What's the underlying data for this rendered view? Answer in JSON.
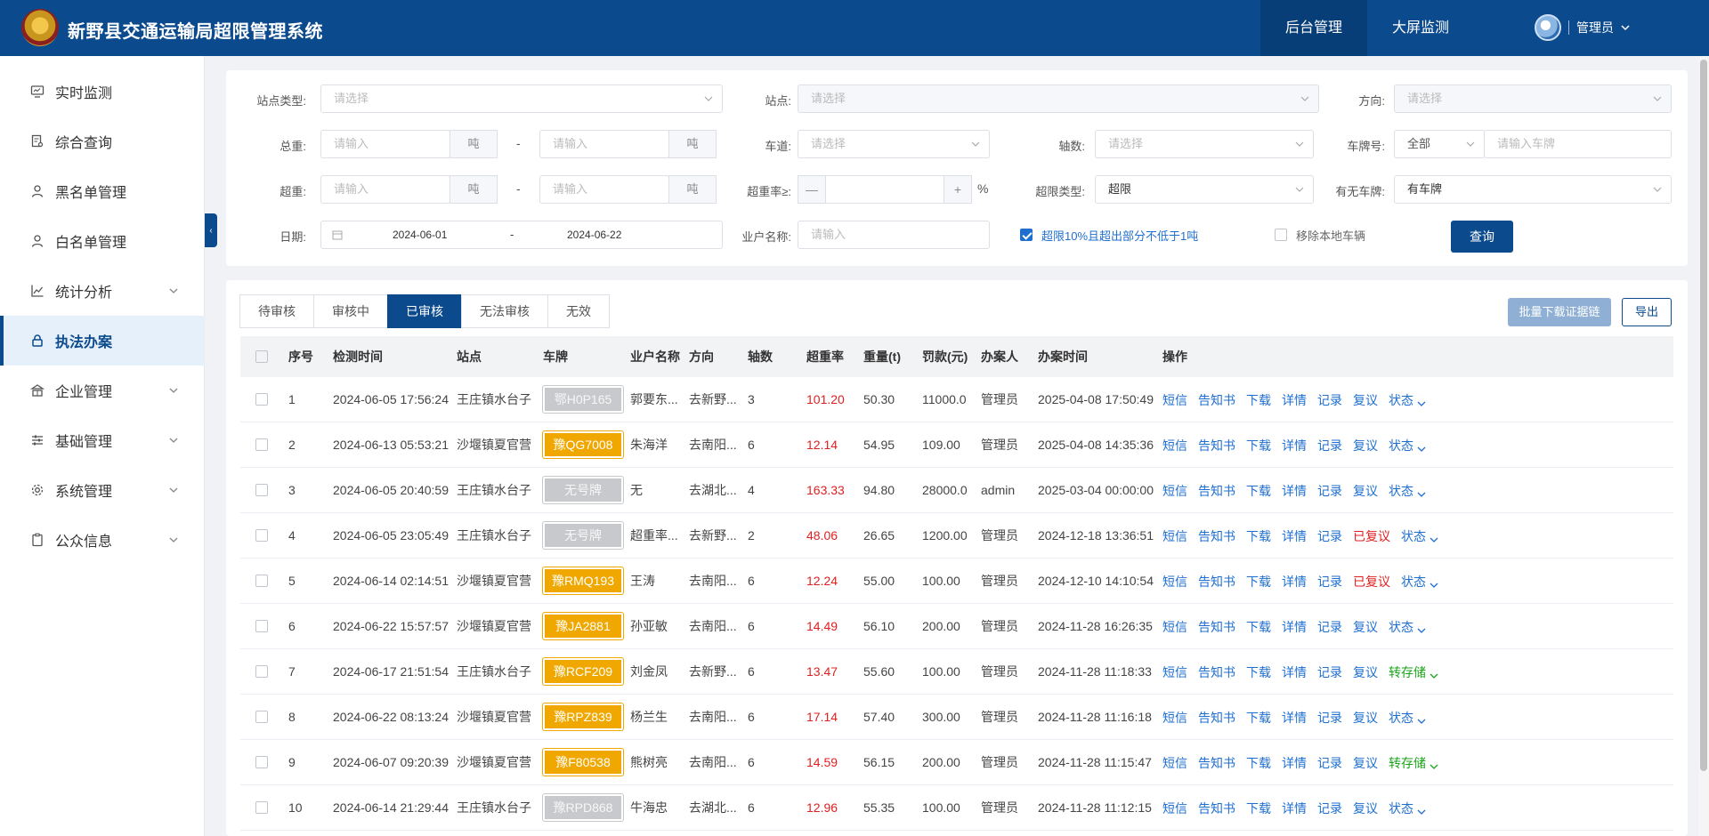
{
  "header": {
    "title": "新野县交通运输局超限管理系统",
    "nav": [
      "后台管理",
      "大屏监测"
    ],
    "user": "管理员"
  },
  "sidebar": {
    "items": [
      {
        "label": "实时监测",
        "icon": "monitor-icon",
        "expandable": false
      },
      {
        "label": "综合查询",
        "icon": "document-search-icon",
        "expandable": false
      },
      {
        "label": "黑名单管理",
        "icon": "user-icon",
        "expandable": false
      },
      {
        "label": "白名单管理",
        "icon": "user-icon",
        "expandable": false
      },
      {
        "label": "统计分析",
        "icon": "chart-icon",
        "expandable": true
      },
      {
        "label": "执法办案",
        "icon": "lock-icon",
        "expandable": false,
        "active": true
      },
      {
        "label": "企业管理",
        "icon": "building-icon",
        "expandable": true
      },
      {
        "label": "基础管理",
        "icon": "sliders-icon",
        "expandable": true
      },
      {
        "label": "系统管理",
        "icon": "gear-icon",
        "expandable": true
      },
      {
        "label": "公众信息",
        "icon": "clipboard-icon",
        "expandable": true
      }
    ]
  },
  "filters": {
    "station_type": {
      "label": "站点类型:",
      "placeholder": "请选择"
    },
    "station": {
      "label": "站点:",
      "placeholder": "请选择"
    },
    "direction": {
      "label": "方向:",
      "placeholder": "请选择"
    },
    "total_weight": {
      "label": "总重:",
      "placeholder": "请输入",
      "unit": "吨"
    },
    "lane": {
      "label": "车道:",
      "placeholder": "请选择"
    },
    "axles": {
      "label": "轴数:",
      "placeholder": "请选择"
    },
    "plate_no": {
      "label": "车牌号:",
      "select": "全部",
      "placeholder": "请输入车牌"
    },
    "overweight": {
      "label": "超重:",
      "placeholder": "请输入",
      "unit": "吨"
    },
    "over_rate": {
      "label": "超重率≥:",
      "minus": "—",
      "plus": "+",
      "unit": "%"
    },
    "overlimit_type": {
      "label": "超限类型:",
      "value": "超限"
    },
    "has_plate": {
      "label": "有无车牌:",
      "value": "有车牌"
    },
    "date": {
      "label": "日期:",
      "start": "2024-06-01",
      "sep": "-",
      "end": "2024-06-22"
    },
    "owner": {
      "label": "业户名称:",
      "placeholder": "请输入"
    },
    "check1": {
      "label": "超限10%且超出部分不低于1吨",
      "checked": true
    },
    "check2": {
      "label": "移除本地车辆",
      "checked": false
    },
    "query_button": "查询",
    "range_sep": "-"
  },
  "tabs": [
    "待审核",
    "审核中",
    "已审核",
    "无法审核",
    "无效"
  ],
  "active_tab": 2,
  "actions": {
    "batch_download": "批量下载证据链",
    "export": "导出"
  },
  "table": {
    "columns": [
      "序号",
      "检测时间",
      "站点",
      "车牌",
      "业户名称",
      "方向",
      "轴数",
      "超重率",
      "重量(t)",
      "罚款(元)",
      "办案人",
      "办案时间",
      "操作"
    ],
    "rows": [
      {
        "no": "1",
        "time": "2024-06-05 17:56:24",
        "station": "王庄镇水台子",
        "plate": "鄂H0P165",
        "plate_color": "gray",
        "owner": "郭要东...",
        "direction": "去新野...",
        "axles": "3",
        "rate": "101.20",
        "weight": "50.30",
        "fine": "11000.0",
        "handler": "管理员",
        "handle_time": "2025-04-08 17:50:49",
        "review": "复议",
        "review_red": false,
        "status": "状态",
        "status_color": "blue"
      },
      {
        "no": "2",
        "time": "2024-06-13 05:53:21",
        "station": "沙堰镇夏官营",
        "plate": "豫QG7008",
        "plate_color": "yellow",
        "owner": "朱海洋",
        "direction": "去南阳...",
        "axles": "6",
        "rate": "12.14",
        "weight": "54.95",
        "fine": "109.00",
        "handler": "管理员",
        "handle_time": "2025-04-08 14:35:36",
        "review": "复议",
        "review_red": false,
        "status": "状态",
        "status_color": "blue"
      },
      {
        "no": "3",
        "time": "2024-06-05 20:40:59",
        "station": "王庄镇水台子",
        "plate": "无号牌",
        "plate_color": "gray",
        "owner": "无",
        "direction": "去湖北...",
        "axles": "4",
        "rate": "163.33",
        "weight": "94.80",
        "fine": "28000.0",
        "handler": "admin",
        "handle_time": "2025-03-04 00:00:00",
        "review": "复议",
        "review_red": false,
        "status": "状态",
        "status_color": "blue"
      },
      {
        "no": "4",
        "time": "2024-06-05 23:05:49",
        "station": "王庄镇水台子",
        "plate": "无号牌",
        "plate_color": "gray",
        "owner": "超重率...",
        "direction": "去新野...",
        "axles": "2",
        "rate": "48.06",
        "weight": "26.65",
        "fine": "1200.00",
        "handler": "管理员",
        "handle_time": "2024-12-18 13:36:51",
        "review": "已复议",
        "review_red": true,
        "status": "状态",
        "status_color": "blue"
      },
      {
        "no": "5",
        "time": "2024-06-14 02:14:51",
        "station": "沙堰镇夏官营",
        "plate": "豫RMQ193",
        "plate_color": "yellow",
        "owner": "王涛",
        "direction": "去南阳...",
        "axles": "6",
        "rate": "12.24",
        "weight": "55.00",
        "fine": "100.00",
        "handler": "管理员",
        "handle_time": "2024-12-10 14:10:54",
        "review": "已复议",
        "review_red": true,
        "status": "状态",
        "status_color": "blue"
      },
      {
        "no": "6",
        "time": "2024-06-22 15:57:57",
        "station": "沙堰镇夏官营",
        "plate": "豫JA2881",
        "plate_color": "yellow",
        "owner": "孙亚敏",
        "direction": "去南阳...",
        "axles": "6",
        "rate": "14.49",
        "weight": "56.10",
        "fine": "200.00",
        "handler": "管理员",
        "handle_time": "2024-11-28 16:26:35",
        "review": "复议",
        "review_red": false,
        "status": "状态",
        "status_color": "blue"
      },
      {
        "no": "7",
        "time": "2024-06-17 21:51:54",
        "station": "王庄镇水台子",
        "plate": "豫RCF209",
        "plate_color": "yellow",
        "owner": "刘金凤",
        "direction": "去新野...",
        "axles": "6",
        "rate": "13.47",
        "weight": "55.60",
        "fine": "100.00",
        "handler": "管理员",
        "handle_time": "2024-11-28 11:18:33",
        "review": "复议",
        "review_red": false,
        "status": "转存储",
        "status_color": "green"
      },
      {
        "no": "8",
        "time": "2024-06-22 08:13:24",
        "station": "沙堰镇夏官营",
        "plate": "豫RPZ839",
        "plate_color": "yellow",
        "owner": "杨兰生",
        "direction": "去南阳...",
        "axles": "6",
        "rate": "17.14",
        "weight": "57.40",
        "fine": "300.00",
        "handler": "管理员",
        "handle_time": "2024-11-28 11:16:18",
        "review": "复议",
        "review_red": false,
        "status": "状态",
        "status_color": "blue"
      },
      {
        "no": "9",
        "time": "2024-06-07 09:20:39",
        "station": "沙堰镇夏官营",
        "plate": "豫F80538",
        "plate_color": "yellow",
        "owner": "熊树亮",
        "direction": "去南阳...",
        "axles": "6",
        "rate": "14.59",
        "weight": "56.15",
        "fine": "200.00",
        "handler": "管理员",
        "handle_time": "2024-11-28 11:15:47",
        "review": "复议",
        "review_red": false,
        "status": "转存储",
        "status_color": "green"
      },
      {
        "no": "10",
        "time": "2024-06-14 21:29:44",
        "station": "王庄镇水台子",
        "plate": "豫RPD868",
        "plate_color": "gray",
        "owner": "牛海忠",
        "direction": "去湖北...",
        "axles": "6",
        "rate": "12.96",
        "weight": "55.35",
        "fine": "100.00",
        "handler": "管理员",
        "handle_time": "2024-11-28 11:12:15",
        "review": "复议",
        "review_red": false,
        "status": "状态",
        "status_color": "blue"
      }
    ],
    "ops": [
      "短信",
      "告知书",
      "下载",
      "详情",
      "记录"
    ]
  },
  "colors": {
    "primary": "#0b4a8c",
    "danger": "#e02020",
    "success": "#1aa51a",
    "plate_yellow": "#f0a800",
    "plate_gray": "#c8c9cc"
  }
}
